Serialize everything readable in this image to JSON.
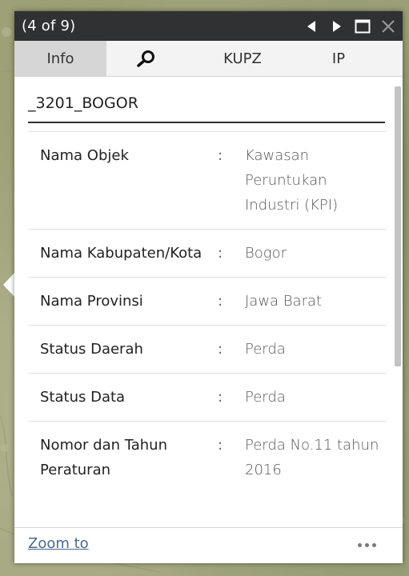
{
  "popup": {
    "counter": "(4 of 9)",
    "controls": {
      "previous_icon": "triangle-left-icon",
      "next_icon": "triangle-right-icon",
      "maximize_icon": "square-outline-icon",
      "close_icon": "x-icon"
    }
  },
  "tabs": [
    {
      "label": "Info",
      "active": true
    },
    {
      "icon": "search-icon"
    },
    {
      "label": "KUPZ"
    },
    {
      "label": "IP"
    }
  ],
  "feature": {
    "title": "_3201_BOGOR"
  },
  "attributes": [
    {
      "label": "Nama Objek",
      "separator": ":",
      "value": "Kawasan Peruntukan Industri (KPI)"
    },
    {
      "label": "Nama Kabupaten/Kota",
      "separator": ":",
      "value": "Bogor"
    },
    {
      "label": "Nama Provinsi",
      "separator": ":",
      "value": "Jawa Barat"
    },
    {
      "label": "Status Daerah",
      "separator": ":",
      "value": "Perda"
    },
    {
      "label": "Status Data",
      "separator": ":",
      "value": "Perda"
    },
    {
      "label": "Nomor dan Tahun Peraturan",
      "separator": ":",
      "value": "Perda No.11 tahun 2016"
    }
  ],
  "footer": {
    "zoom_label": "Zoom to",
    "more_icon": "ellipsis-icon"
  },
  "colors": {
    "titlebar": "#2f3132",
    "active_tab": "#d6d6d6",
    "link": "#4a6a8f"
  }
}
